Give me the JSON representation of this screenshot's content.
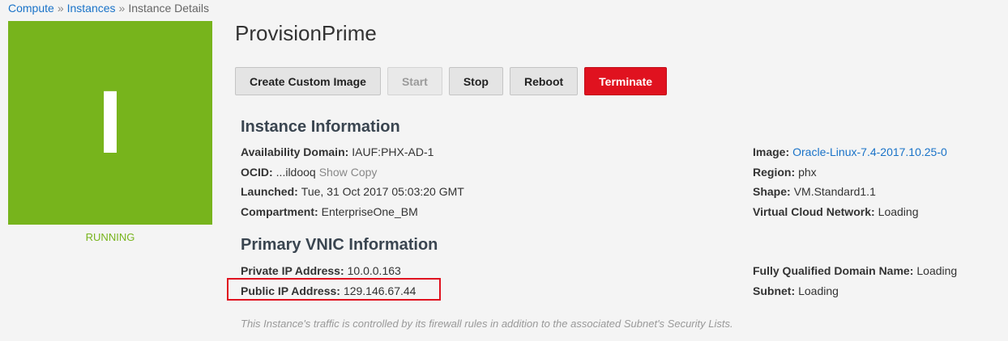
{
  "breadcrumb": {
    "items": [
      "Compute",
      "Instances",
      "Instance Details"
    ],
    "separator": "»"
  },
  "instance": {
    "tile_letter": "I",
    "state": "RUNNING",
    "name": "ProvisionPrime"
  },
  "actions": {
    "create_custom_image": "Create Custom Image",
    "start": "Start",
    "stop": "Stop",
    "reboot": "Reboot",
    "terminate": "Terminate"
  },
  "instance_info": {
    "title": "Instance Information",
    "availability_domain": {
      "label": "Availability Domain:",
      "value": "IAUF:PHX-AD-1"
    },
    "ocid": {
      "label": "OCID:",
      "value": "...ildooq",
      "show": "Show",
      "copy": "Copy"
    },
    "launched": {
      "label": "Launched:",
      "value": "Tue, 31 Oct 2017 05:03:20 GMT"
    },
    "compartment": {
      "label": "Compartment:",
      "value": "EnterpriseOne_BM"
    },
    "image": {
      "label": "Image:",
      "value": "Oracle-Linux-7.4-2017.10.25-0"
    },
    "region": {
      "label": "Region:",
      "value": "phx"
    },
    "shape": {
      "label": "Shape:",
      "value": "VM.Standard1.1"
    },
    "vcn": {
      "label": "Virtual Cloud Network:",
      "value": "Loading"
    }
  },
  "vnic_info": {
    "title": "Primary VNIC Information",
    "private_ip": {
      "label": "Private IP Address:",
      "value": "10.0.0.163"
    },
    "public_ip": {
      "label": "Public IP Address:",
      "value": "129.146.67.44"
    },
    "fqdn": {
      "label": "Fully Qualified Domain Name:",
      "value": "Loading"
    },
    "subnet": {
      "label": "Subnet:",
      "value": "Loading"
    },
    "note": "This Instance's traffic is controlled by its firewall rules in addition to the associated Subnet's Security Lists."
  },
  "colors": {
    "running": "#77b41c",
    "link": "#1a73c8",
    "danger": "#e0121f"
  }
}
